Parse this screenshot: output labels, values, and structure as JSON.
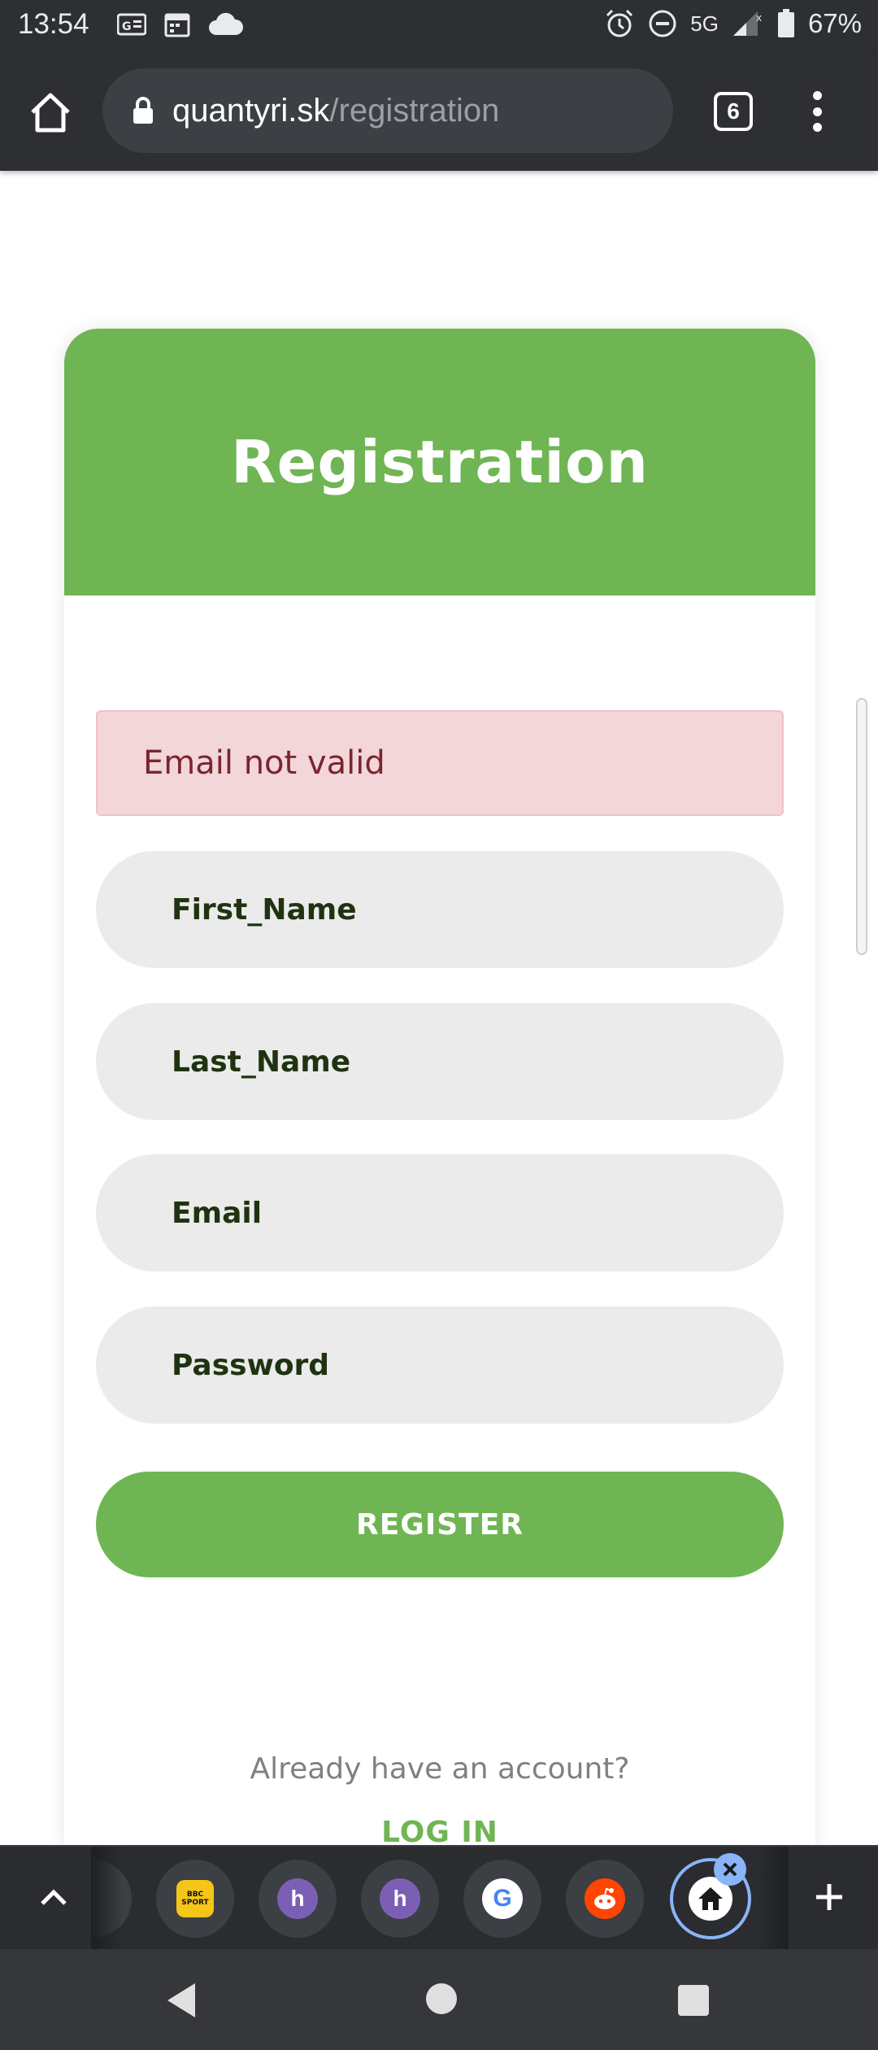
{
  "status_bar": {
    "time": "13:54",
    "network": "5G",
    "battery": "67%",
    "left_icons": [
      "news-icon",
      "calendar-icon",
      "cloud-icon"
    ],
    "right_icons": [
      "alarm-icon",
      "do-not-disturb-icon",
      "signal-icon",
      "battery-icon"
    ]
  },
  "browser": {
    "url_host": "quantyri.sk",
    "url_path": "/registration",
    "tab_count": "6"
  },
  "page": {
    "title": "Registration",
    "alert": "Email not valid",
    "fields": {
      "first_name": "First_Name",
      "last_name": "Last_Name",
      "email": "Email",
      "password": "Password"
    },
    "register_label": "REGISTER",
    "login_prompt": "Already have an account?",
    "login_label": "LOG IN"
  },
  "tab_strip": {
    "tabs": [
      {
        "name": "partial-tab"
      },
      {
        "name": "bbc-sport",
        "label_top": "BBC",
        "label_bottom": "SPORT"
      },
      {
        "name": "heroku",
        "glyph": "h"
      },
      {
        "name": "heroku",
        "glyph": "h"
      },
      {
        "name": "google",
        "glyph": "G"
      },
      {
        "name": "reddit"
      },
      {
        "name": "home",
        "active": true
      }
    ]
  },
  "colors": {
    "brand_green": "#6fb553",
    "alert_bg": "#f3d6d9",
    "alert_text": "#7a2530",
    "chrome_dark": "#2d2f33"
  }
}
